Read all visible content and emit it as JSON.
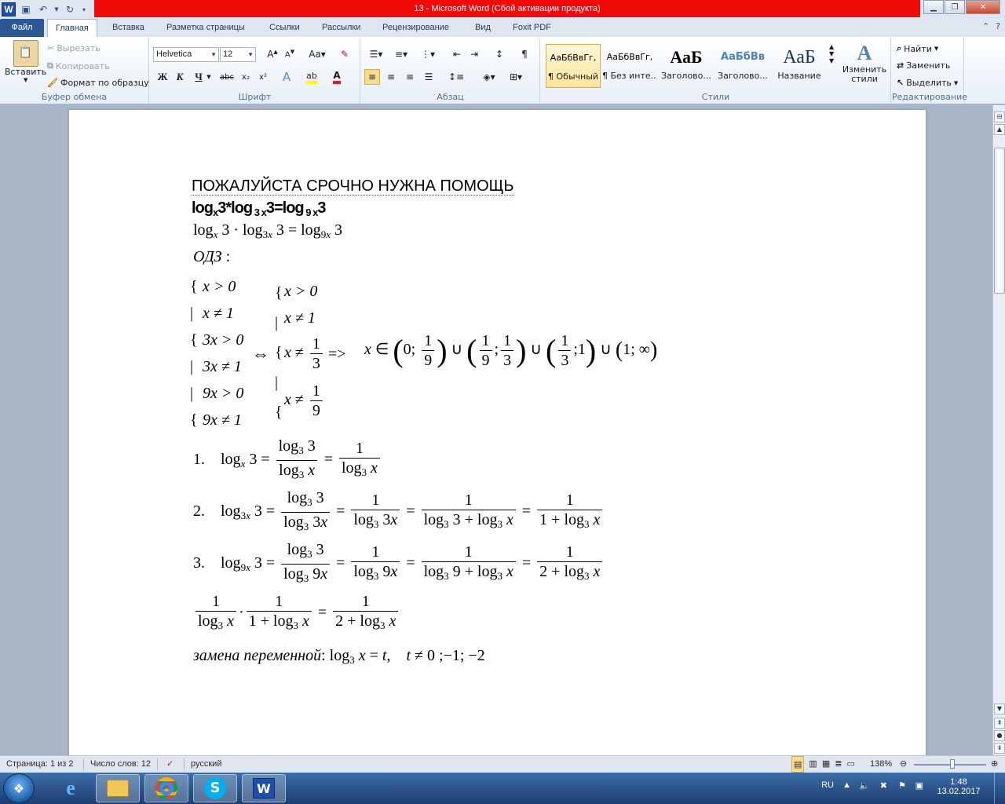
{
  "window": {
    "title": "13  -  Microsoft Word (Сбой активации продукта)"
  },
  "tabs": [
    "Файл",
    "Главная",
    "Вставка",
    "Разметка страницы",
    "Ссылки",
    "Рассылки",
    "Рецензирование",
    "Вид",
    "Foxit PDF"
  ],
  "ribbon": {
    "clipboard": {
      "label": "Буфер обмена",
      "paste": "Вставить",
      "cut": "Вырезать",
      "copy": "Копировать",
      "format_painter": "Формат по образцу"
    },
    "font": {
      "label": "Шрифт",
      "font_name": "Helvetica",
      "font_size": "12",
      "bold": "Ж",
      "italic": "К",
      "underline": "Ч",
      "strike": "abc",
      "subscript": "x₂",
      "superscript": "x²"
    },
    "paragraph": {
      "label": "Абзац"
    },
    "styles": {
      "label": "Стили",
      "items": [
        {
          "sample": "АаБбВвГг,",
          "name": "¶ Обычный"
        },
        {
          "sample": "АаБбВвГг,",
          "name": "¶ Без инте..."
        },
        {
          "sample": "АаБ",
          "name": "Заголово..."
        },
        {
          "sample": "АаБбВв",
          "name": "Заголово..."
        },
        {
          "sample": "АаБ",
          "name": "Название"
        }
      ],
      "change_styles": "Изменить стили"
    },
    "editing": {
      "label": "Редактирование",
      "find": "Найти",
      "replace": "Заменить",
      "select": "Выделить"
    }
  },
  "document": {
    "heading": "ПОЖАЛУЙСТА СРОЧНО НУЖНА ПОМОЩЬ",
    "odz": "ОДЗ",
    "system1": [
      "x > 0",
      "x ≠ 1",
      "3x > 0",
      "3x ≠ 1",
      "9x > 0",
      "9x ≠ 1"
    ],
    "system2_simple": [
      "x > 0",
      "x ≠ 1"
    ],
    "arrow": "=>",
    "step1_num": "1.",
    "step2_num": "2.",
    "step3_num": "3.",
    "substitution": "замена переменной"
  },
  "statusbar": {
    "page": "Страница: 1 из 2",
    "words": "Число слов: 12",
    "language": "русский",
    "zoom": "138%"
  },
  "taskbar": {
    "lang": "RU",
    "time": "1:48",
    "date": "13.02.2017"
  },
  "colors": {
    "title_red": "#f20a0a",
    "file_tab": "#2b5797",
    "taskbar": "#1c3f70"
  }
}
